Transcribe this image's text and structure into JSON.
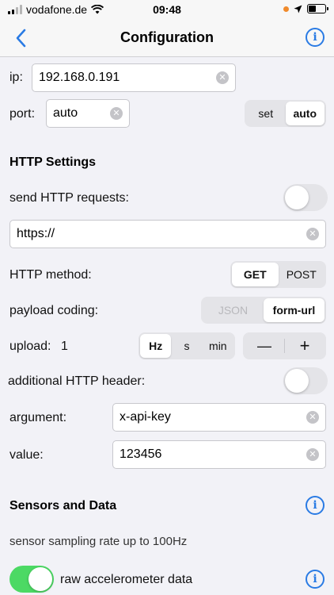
{
  "status_bar": {
    "carrier": "vodafone.de",
    "time": "09:48"
  },
  "nav": {
    "title": "Configuration"
  },
  "connection": {
    "ip_label": "ip:",
    "ip_value": "192.168.0.191",
    "port_label": "port:",
    "port_value": "auto",
    "port_mode": {
      "options": [
        "set",
        "auto"
      ],
      "selected": "auto"
    }
  },
  "http": {
    "header": "HTTP Settings",
    "send_label": "send HTTP requests:",
    "send_enabled": false,
    "url_value": "https://",
    "method_label": "HTTP method:",
    "method": {
      "options": [
        "GET",
        "POST"
      ],
      "selected": "GET"
    },
    "payload_label": "payload coding:",
    "payload": {
      "options": [
        "JSON",
        "form-url"
      ],
      "selected": "form-url"
    },
    "upload_label": "upload:",
    "upload_value": "1",
    "upload_unit": {
      "options": [
        "Hz",
        "s",
        "min"
      ],
      "selected": "Hz"
    },
    "stepper": {
      "minus": "—",
      "plus": "+"
    },
    "additional_header_label": "additional HTTP header:",
    "additional_header_enabled": false,
    "argument_label": "argument:",
    "argument_value": "x-api-key",
    "value_label": "value:",
    "value_value": "123456"
  },
  "sensors": {
    "header": "Sensors and Data",
    "sampling_note": "sensor sampling rate up to 100Hz",
    "raw_accel_label": "raw accelerometer data",
    "raw_accel_enabled": true
  },
  "colors": {
    "accent": "#2a7be4",
    "toggle_on": "#4cd964",
    "background": "#f2f2f7"
  },
  "icons": {
    "back": "chevron-left-icon",
    "info": "info-circle-icon",
    "clear": "clear-x-icon",
    "wifi": "wifi-icon",
    "location": "location-arrow-icon",
    "battery": "battery-icon"
  }
}
